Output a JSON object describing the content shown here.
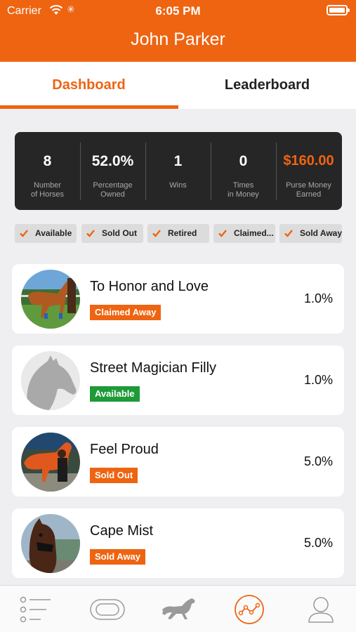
{
  "status_bar": {
    "carrier": "Carrier",
    "time": "6:05 PM"
  },
  "header": {
    "title": "John Parker"
  },
  "tabs": [
    {
      "label": "Dashboard",
      "active": true
    },
    {
      "label": "Leaderboard",
      "active": false
    }
  ],
  "stats": [
    {
      "value": "8",
      "label_line1": "Number",
      "label_line2": "of Horses"
    },
    {
      "value": "52.0%",
      "label_line1": "Percentage",
      "label_line2": "Owned"
    },
    {
      "value": "1",
      "label_line1": "Wins",
      "label_line2": ""
    },
    {
      "value": "0",
      "label_line1": "Times",
      "label_line2": "in Money"
    },
    {
      "value": "$160.00",
      "label_line1": "Purse Money",
      "label_line2": "Earned"
    }
  ],
  "filters": [
    {
      "label": "Available",
      "checked": true
    },
    {
      "label": "Sold Out",
      "checked": true
    },
    {
      "label": "Retired",
      "checked": true
    },
    {
      "label": "Claimed...",
      "checked": true
    },
    {
      "label": "Sold Away",
      "checked": true
    }
  ],
  "horses": [
    {
      "name": "To Honor and Love",
      "status": "Claimed Away",
      "status_color": "#ee6411",
      "ownership": "1.0%",
      "avatar": "photo-chestnut-horse"
    },
    {
      "name": "Street Magician Filly",
      "status": "Available",
      "status_color": "#1e9a38",
      "ownership": "1.0%",
      "avatar": "placeholder-horse-head-icon"
    },
    {
      "name": "Feel Proud",
      "status": "Sold Out",
      "status_color": "#ee6411",
      "ownership": "5.0%",
      "avatar": "photo-horse-with-handler"
    },
    {
      "name": "Cape Mist",
      "status": "Sold Away",
      "status_color": "#ee6411",
      "ownership": "5.0%",
      "avatar": "photo-bay-horse-head"
    }
  ],
  "tab_bar": [
    {
      "icon": "list-icon",
      "active": false
    },
    {
      "icon": "racetrack-icon",
      "active": false
    },
    {
      "icon": "running-horse-icon",
      "active": false
    },
    {
      "icon": "analytics-icon",
      "active": true
    },
    {
      "icon": "profile-icon",
      "active": false
    }
  ],
  "colors": {
    "accent": "#ee6411",
    "available": "#1e9a38",
    "stats_bg": "#262626",
    "page_bg": "#efeff1"
  }
}
